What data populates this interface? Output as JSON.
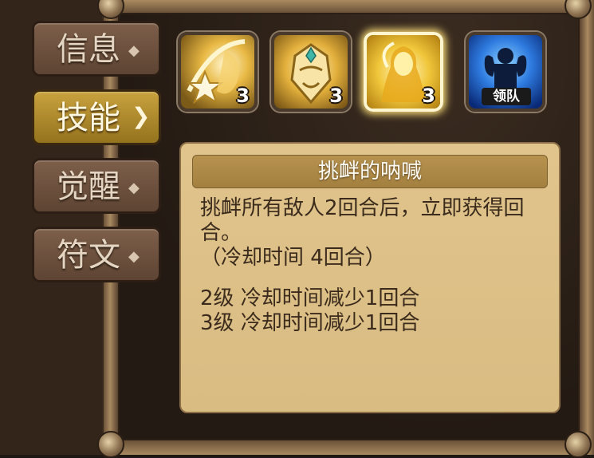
{
  "tabs": [
    {
      "label": "信息",
      "active": false
    },
    {
      "label": "技能",
      "active": true
    },
    {
      "label": "觉醒",
      "active": false
    },
    {
      "label": "符文",
      "active": false
    }
  ],
  "skills": [
    {
      "icon": "star-fox-skill-icon",
      "level": "3",
      "selected": false
    },
    {
      "icon": "golden-mask-skill-icon",
      "level": "3",
      "selected": false
    },
    {
      "icon": "golden-figure-skill-icon",
      "level": "3",
      "selected": true
    },
    {
      "icon": "leader-muscle-icon",
      "badge": "领队",
      "selected": false
    }
  ],
  "skill_detail": {
    "title": "挑衅的呐喊",
    "description_line1": "挑衅所有敌人2回合后，立即获得回",
    "description_line2": "合。",
    "cooldown": "（冷却时间 4回合）",
    "upgrade_1": "2级 冷却时间减少1回合",
    "upgrade_2": "3级 冷却时间减少1回合"
  },
  "colors": {
    "active_tab": "#c9a23e",
    "inactive_tab": "#6d513e",
    "parchment": "#dcc088",
    "title_bar": "#ac8846"
  }
}
